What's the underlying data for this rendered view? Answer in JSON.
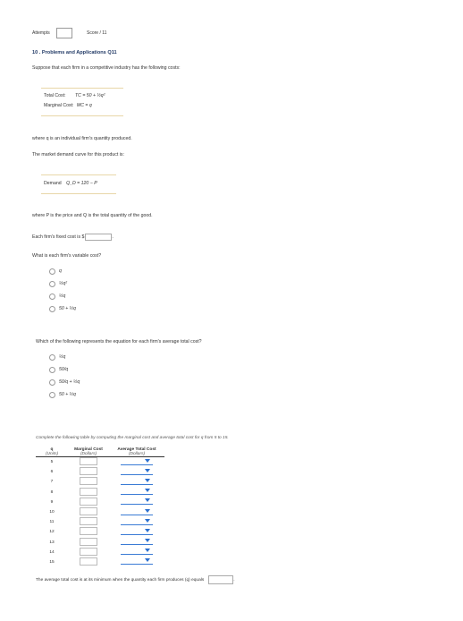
{
  "header": {
    "attempts_label": "Attempts",
    "score_label": "Score / 11"
  },
  "question": {
    "title": "10 . Problems and Applications Q11",
    "intro": "Suppose that each firm in a competitive industry has the following costs:",
    "total_cost_label": "Total Cost:",
    "total_cost_formula": "TC = 50 + ½q²",
    "marginal_cost_label": "Marginal Cost:",
    "marginal_cost_formula": "MC = q",
    "where_q": "where q is an individual firm's quantity produced.",
    "market_demand_intro": "The market demand curve for this product is:",
    "demand_label": "Demand",
    "demand_formula": "Q_D = 120 − P",
    "where_p": "where P is the price and Q is the total quantity of the good.",
    "fixed_cost_label": "Each firm's fixed cost is $",
    "fixed_cost_value": "",
    "fixed_cost_suffix": ".",
    "variable_cost_question": "What is each firm's variable cost?",
    "variable_cost_options": [
      "q",
      "½q²",
      "½q",
      "50 + ½q"
    ],
    "atc_question": "Which of the following represents the equation for each firm's average total cost?",
    "atc_options": [
      "½q",
      "50/q",
      "50/q + ½q",
      "50 + ½q"
    ],
    "table_instructions": "Complete the following table by computing the marginal cost and average total cost for q from 5 to 15.",
    "table": {
      "headers": [
        "q",
        "Marginal Cost",
        "Average Total Cost"
      ],
      "units": [
        "(Units)",
        "(Dollars)",
        "(Dollars)"
      ],
      "rows": [
        "5",
        "6",
        "7",
        "8",
        "9",
        "10",
        "11",
        "12",
        "13",
        "14",
        "15"
      ]
    },
    "final_statement": "The average total cost is at its minimum when the quantity each firm produces (q) equals",
    "final_suffix": "."
  }
}
